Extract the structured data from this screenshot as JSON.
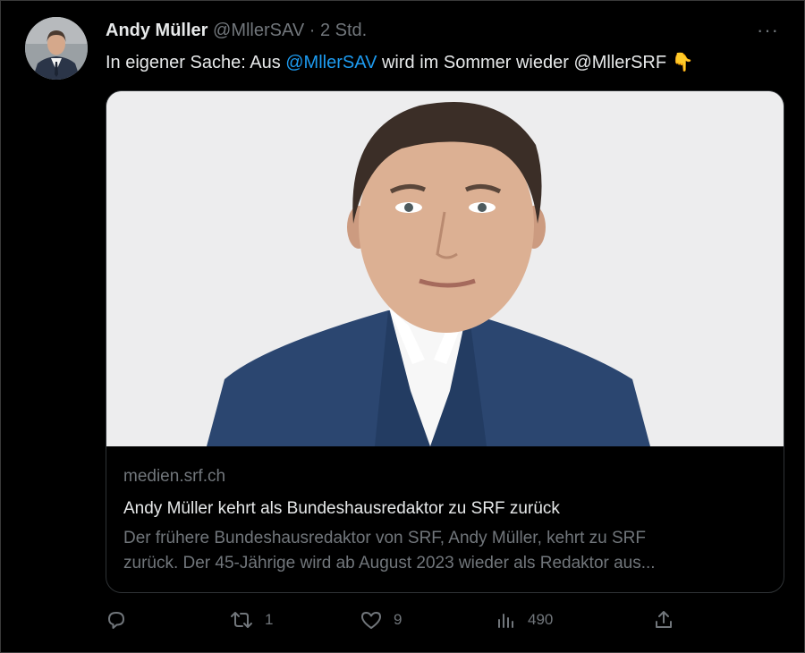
{
  "tweet": {
    "author_name": "Andy Müller",
    "handle": "@MllerSAV",
    "separator": "·",
    "time": "2 Std.",
    "more_label": "···",
    "text_prefix": "In eigener Sache: Aus ",
    "mention_1": "@MllerSAV",
    "text_middle": " wird im Sommer wieder @MllerSRF ",
    "emoji": "👇"
  },
  "card": {
    "domain": "medien.srf.ch",
    "title": "Andy Müller kehrt als Bundeshausredaktor zu SRF zurück",
    "description_line1": "Der frühere Bundeshausredaktor von SRF, Andy Müller, kehrt zu SRF",
    "description_line2": "zurück. Der 45-Jährige wird ab August 2023 wieder als Redaktor aus..."
  },
  "actions": {
    "reply_count": "",
    "retweet_count": "1",
    "like_count": "9",
    "views_count": "490"
  },
  "colors": {
    "background": "#000000",
    "text": "#e7e9ea",
    "muted": "#71767b",
    "accent": "#1d9bf0",
    "card_border": "#2f3336",
    "photo_bg": "#ededee",
    "suit": "#2b4670"
  },
  "icons": [
    "reply-icon",
    "retweet-icon",
    "like-icon",
    "views-icon",
    "share-icon",
    "more-icon"
  ]
}
